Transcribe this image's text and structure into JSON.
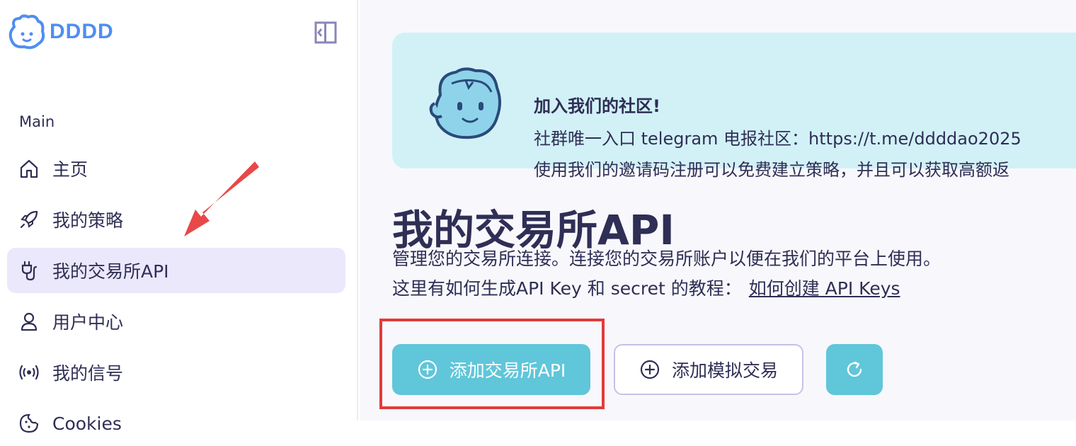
{
  "brand": {
    "name": "DDDD",
    "accent": "#4f8ef0"
  },
  "sidebar": {
    "section": "Main",
    "items": [
      {
        "label": "主页",
        "icon": "home-icon"
      },
      {
        "label": "我的策略",
        "icon": "rocket-icon"
      },
      {
        "label": "我的交易所API",
        "icon": "plug-icon",
        "active": true
      },
      {
        "label": "用户中心",
        "icon": "user-icon"
      },
      {
        "label": "我的信号",
        "icon": "broadcast-icon"
      },
      {
        "label": "Cookies",
        "icon": "cookie-icon"
      }
    ]
  },
  "banner": {
    "title": "加入我们的社区!",
    "line1": "社群唯一入口 telegram 电报社区：https://t.me/ddddao2025",
    "line2": "使用我们的邀请码注册可以免费建立策略，并且可以获取高额返"
  },
  "main": {
    "title": "我的交易所API",
    "desc1": "管理您的交易所连接。连接您的交易所账户以便在我们的平台上使用。",
    "desc2": "这里有如何生成API Key 和 secret 的教程：",
    "link": "如何创建 API Keys",
    "add_exchange_label": "添加交易所API",
    "add_sim_label": "添加模拟交易"
  },
  "colors": {
    "primary_button": "#60c6d9",
    "active_nav": "#ebe8fb",
    "banner": "#d2f1f7",
    "annotation_red": "#e13b3b"
  }
}
